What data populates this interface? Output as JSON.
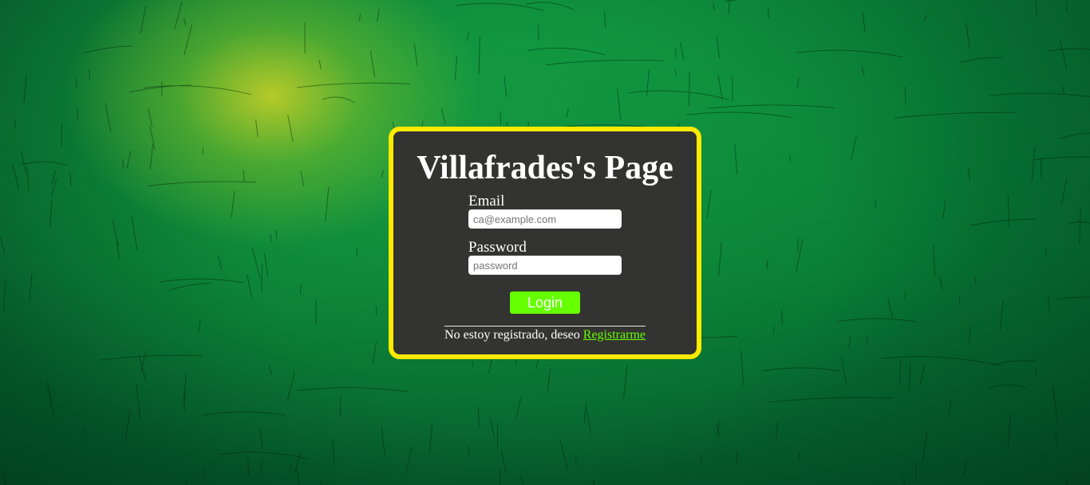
{
  "page": {
    "title": "Villafrades's Page"
  },
  "login_form": {
    "email_label": "Email",
    "email_placeholder": "ca@example.com",
    "email_value": "",
    "password_label": "Password",
    "password_placeholder": "password",
    "password_value": "",
    "login_button_label": "Login"
  },
  "register": {
    "prompt_text": "No estoy registrado, deseo ",
    "link_label": "Registrarme"
  },
  "colors": {
    "background": "#0a8a3a",
    "card_background": "#333331",
    "card_border": "#ffea00",
    "accent_green": "#66ff00",
    "text": "#ffffff"
  }
}
